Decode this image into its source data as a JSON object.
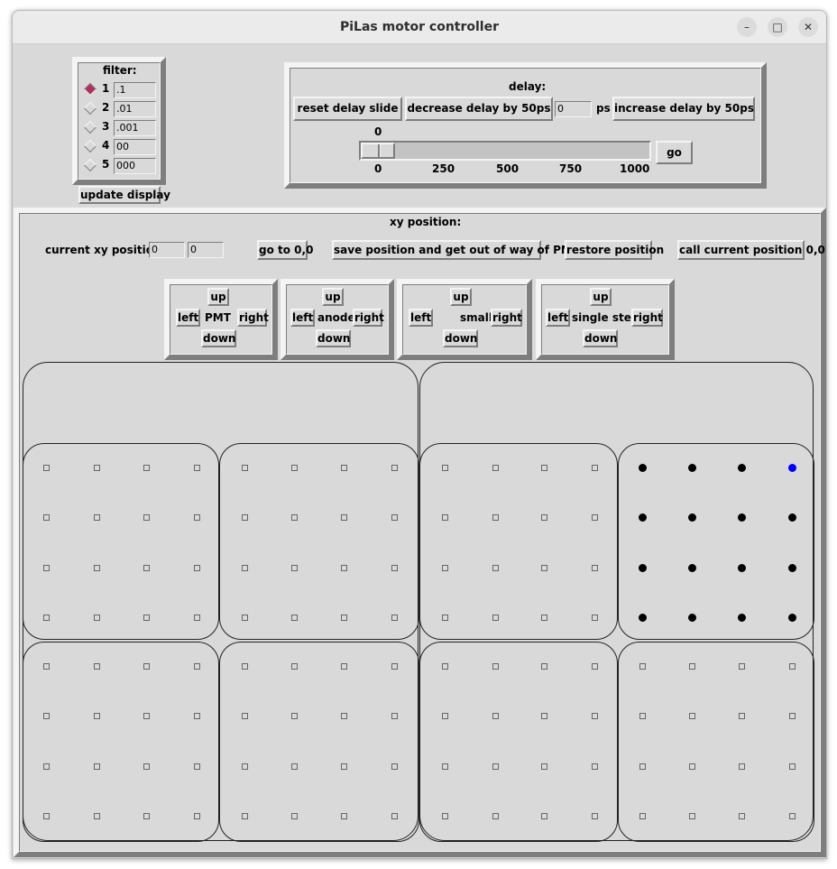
{
  "window": {
    "title": "PiLas motor controller",
    "controls": [
      "–",
      "□",
      "✕"
    ]
  },
  "filter": {
    "title": "filter:",
    "items": [
      {
        "num": "1",
        "value": ".1",
        "selected": true
      },
      {
        "num": "2",
        "value": ".01",
        "selected": false
      },
      {
        "num": "3",
        "value": ".001",
        "selected": false
      },
      {
        "num": "4",
        "value": "00",
        "selected": false
      },
      {
        "num": "5",
        "value": "000",
        "selected": false
      }
    ],
    "update_label": "update display"
  },
  "delay": {
    "title": "delay:",
    "reset_label": "reset delay slide",
    "decrease_label": "decrease delay by 50ps",
    "value": "0",
    "unit": "ps",
    "increase_label": "increase delay by 50ps",
    "slider_value": "0",
    "slider_min": 0,
    "slider_max": 1000,
    "ticks": [
      "0",
      "250",
      "500",
      "750",
      "1000"
    ],
    "go_label": "go"
  },
  "xy": {
    "title": "xy position:",
    "current_label": "current xy position:",
    "x": "0",
    "y": "0",
    "goto_label": "go to 0,0",
    "save_label": "save position and get out of way of PMT",
    "restore_label": "restore position",
    "call_label": "call current position 0,0"
  },
  "pads": [
    {
      "center": "PMT",
      "up": "up",
      "left": "left",
      "right": "right",
      "down": "down"
    },
    {
      "center": "anode",
      "up": "up",
      "left": "left",
      "right": "right",
      "down": "down"
    },
    {
      "center": "small step",
      "up": "up",
      "left": "left",
      "right": "right",
      "down": "down"
    },
    {
      "center": "single step",
      "up": "up",
      "left": "left",
      "right": "right",
      "down": "down"
    }
  ],
  "grid": {
    "rows_per_cell": 4,
    "cols_per_cell": 4,
    "active_cell": 3,
    "selected_point": {
      "row": 0,
      "col": 3
    },
    "colors": {
      "filled": "#000000",
      "selected": "#0000ff",
      "empty_border": "#666666"
    }
  }
}
